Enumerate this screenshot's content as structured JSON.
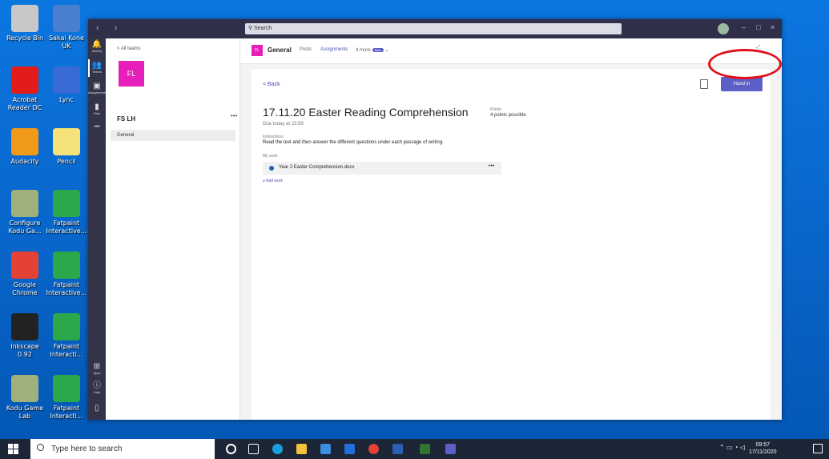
{
  "desktop": {
    "icons": [
      {
        "label": "Recycle Bin",
        "color": "#c8c8c8"
      },
      {
        "label": "Sakai Kone\nUK",
        "color": "#4a7fd0"
      },
      {
        "label": "Acrobat\nReader DC",
        "color": "#e21b1b"
      },
      {
        "label": "Lync",
        "color": "#3a6ad6"
      },
      {
        "label": "Audacity",
        "color": "#f19a1a"
      },
      {
        "label": "Pencil",
        "color": "#f6e27a"
      },
      {
        "label": "Configure\nKodu Ga...",
        "color": "#9fb07c"
      },
      {
        "label": "Fatpaint\nInteractive...",
        "color": "#2ba94a"
      },
      {
        "label": "Google\nChrome",
        "color": "#e34234"
      },
      {
        "label": "Fatpaint\nInteractive...",
        "color": "#2ba94a"
      },
      {
        "label": "Inkscape 0.92",
        "color": "#222222"
      },
      {
        "label": "Fatpaint\nInteracti...",
        "color": "#2ba94a"
      },
      {
        "label": "Kodu Game\nLab",
        "color": "#9fb07c"
      },
      {
        "label": "Fatpaint\nInteracti...",
        "color": "#2ba94a"
      }
    ]
  },
  "teams": {
    "search_placeholder": "Search",
    "window_controls": {
      "minimize": "–",
      "maximize": "□",
      "close": "×"
    },
    "rail": [
      {
        "icon": "bell",
        "label": "Activity"
      },
      {
        "icon": "teams",
        "label": "Teams"
      },
      {
        "icon": "assignments",
        "label": "Assignments"
      },
      {
        "icon": "files",
        "label": "Files"
      },
      {
        "icon": "more",
        "label": "•••"
      },
      {
        "icon": "apps",
        "label": "Apps"
      },
      {
        "icon": "help",
        "label": "Help"
      }
    ],
    "team_pane": {
      "all_teams": "< All teams",
      "avatar_initials": "FL",
      "team_name": "FS LH",
      "more": "•••",
      "channel": "General"
    },
    "channel_header": {
      "avatar_initials": "FL",
      "title": "General",
      "tabs": [
        "Posts",
        "Assignments",
        "4 more"
      ],
      "new_badge": "New"
    },
    "assignment": {
      "back": "< Back",
      "hand_in": "Hand in",
      "title": "17.11.20 Easter Reading Comprehension",
      "due": "Due today at 23:59",
      "points_label": "Points",
      "points_value": "4 points possible",
      "instructions_label": "Instructions",
      "instructions_text": "Read the text and then answer the different questions under each passage of writing.",
      "my_work_label": "My work",
      "file_name": "Year 2 Easter Comprehension.docx",
      "file_more": "•••",
      "add_work": "Add work"
    }
  },
  "taskbar": {
    "search_placeholder": "Type here to search",
    "time": "09:57",
    "date": "17/11/2020"
  },
  "colors": {
    "accent": "#5b5fc7",
    "team_color": "#e61fba",
    "annotation": "#e0101c"
  }
}
